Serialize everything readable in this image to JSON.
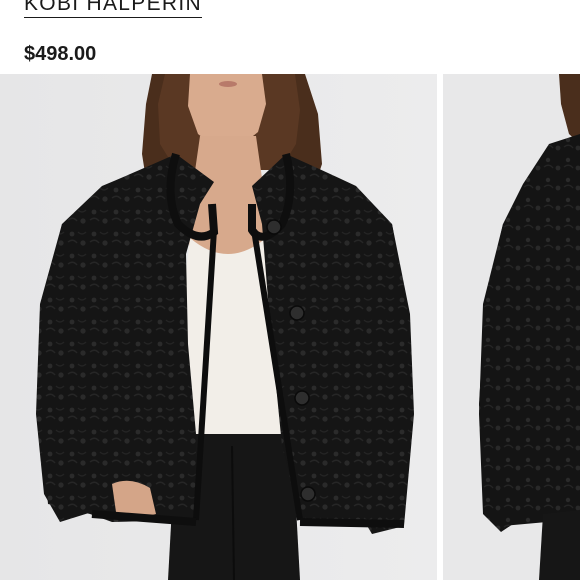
{
  "product": {
    "brand": "KOBI HALPERIN",
    "price": "$498.00"
  },
  "gallery": {
    "images": [
      {
        "name": "product-photo-front",
        "alt": "Black crochet cardigan, front view"
      },
      {
        "name": "product-photo-side",
        "alt": "Black crochet cardigan, side view"
      }
    ]
  },
  "colors": {
    "background": "#ffffff",
    "photo_background": "#e9e9ea",
    "text": "#1a1a1a",
    "garment": "#121212"
  }
}
